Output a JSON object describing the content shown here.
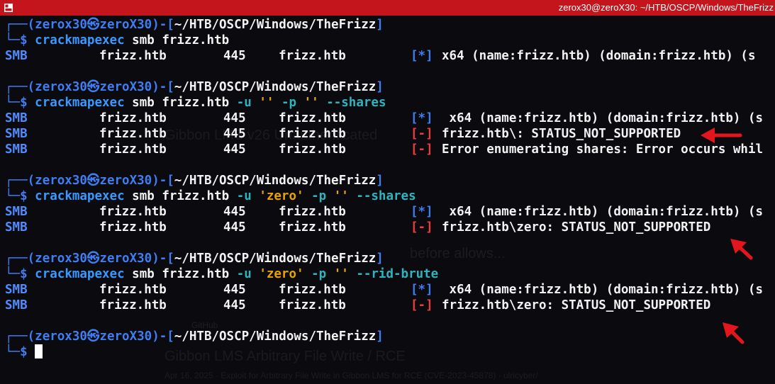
{
  "window": {
    "title": "zerox30@zeroX30: ~/HTB/OSCP/Windows/TheFrizz",
    "accent_color": "#c4151c"
  },
  "prompt": {
    "user": "zerox30",
    "host": "zeroX30",
    "cwd": "~/HTB/OSCP/Windows/TheFrizz",
    "symbol": "$",
    "skull_icon": "kali-skull-icon"
  },
  "commands": [
    {
      "program": "crackmapexec",
      "tokens": [
        {
          "t": "smb",
          "c": "arg"
        },
        {
          "t": "frizz.htb",
          "c": "arg"
        }
      ],
      "output": [
        {
          "proto": "SMB",
          "host": "frizz.htb",
          "port": "445",
          "name": "frizz.htb",
          "mark": "[*]",
          "mark_type": "info",
          "msg": "x64 (name:frizz.htb) (domain:frizz.htb) (s"
        }
      ]
    },
    {
      "program": "crackmapexec",
      "tokens": [
        {
          "t": "smb",
          "c": "arg"
        },
        {
          "t": "frizz.htb",
          "c": "arg"
        },
        {
          "t": "-u",
          "c": "opt"
        },
        {
          "t": "''",
          "c": "str"
        },
        {
          "t": "-p",
          "c": "opt"
        },
        {
          "t": "''",
          "c": "str"
        },
        {
          "t": "--shares",
          "c": "opt"
        }
      ],
      "output": [
        {
          "proto": "SMB",
          "host": "frizz.htb",
          "port": "445",
          "name": "frizz.htb",
          "mark": "[*]",
          "mark_type": "info",
          "msg": " x64 (name:frizz.htb) (domain:frizz.htb) (s"
        },
        {
          "proto": "SMB",
          "host": "frizz.htb",
          "port": "445",
          "name": "frizz.htb",
          "mark": "[-]",
          "mark_type": "fail",
          "msg": "frizz.htb\\: STATUS_NOT_SUPPORTED"
        },
        {
          "proto": "SMB",
          "host": "frizz.htb",
          "port": "445",
          "name": "frizz.htb",
          "mark": "[-]",
          "mark_type": "fail",
          "msg": "Error enumerating shares: Error occurs whil"
        }
      ]
    },
    {
      "program": "crackmapexec",
      "tokens": [
        {
          "t": "smb",
          "c": "arg"
        },
        {
          "t": "frizz.htb",
          "c": "arg"
        },
        {
          "t": "-u",
          "c": "opt"
        },
        {
          "t": "'zero'",
          "c": "str"
        },
        {
          "t": "-p",
          "c": "opt"
        },
        {
          "t": "''",
          "c": "str"
        },
        {
          "t": "--shares",
          "c": "opt"
        }
      ],
      "output": [
        {
          "proto": "SMB",
          "host": "frizz.htb",
          "port": "445",
          "name": "frizz.htb",
          "mark": "[*]",
          "mark_type": "info",
          "msg": " x64 (name:frizz.htb) (domain:frizz.htb) (s"
        },
        {
          "proto": "SMB",
          "host": "frizz.htb",
          "port": "445",
          "name": "frizz.htb",
          "mark": "[-]",
          "mark_type": "fail",
          "msg": "frizz.htb\\zero: STATUS_NOT_SUPPORTED"
        }
      ]
    },
    {
      "program": "crackmapexec",
      "tokens": [
        {
          "t": "smb",
          "c": "arg"
        },
        {
          "t": "frizz.htb",
          "c": "arg"
        },
        {
          "t": "-u",
          "c": "opt"
        },
        {
          "t": "'zero'",
          "c": "str"
        },
        {
          "t": "-p",
          "c": "opt"
        },
        {
          "t": "''",
          "c": "str"
        },
        {
          "t": "--rid-brute",
          "c": "opt"
        }
      ],
      "output": [
        {
          "proto": "SMB",
          "host": "frizz.htb",
          "port": "445",
          "name": "frizz.htb",
          "mark": "[*]",
          "mark_type": "info",
          "msg": " x64 (name:frizz.htb) (domain:frizz.htb) (s"
        },
        {
          "proto": "SMB",
          "host": "frizz.htb",
          "port": "445",
          "name": "frizz.htb",
          "mark": "[-]",
          "mark_type": "fail",
          "msg": "frizz.htb\\zero: STATUS_NOT_SUPPORTED"
        }
      ]
    }
  ],
  "annotations": {
    "arrow_color": "#e3161e",
    "arrows": [
      "red-arrow-left",
      "red-arrow-up-left",
      "red-arrow-up-left"
    ]
  },
  "background_ghost": [
    "Gibbon LMS v26 Unauthenticated",
    "Apr 16, 2025 · Exploit for Arbitrary File Write in Gibbon LMS for RCE (CVE-2023-45878) · ulricyber/",
    "GitHub",
    "Gibbon LMS Arbitrary File Write / RCE",
    "before allows..."
  ]
}
